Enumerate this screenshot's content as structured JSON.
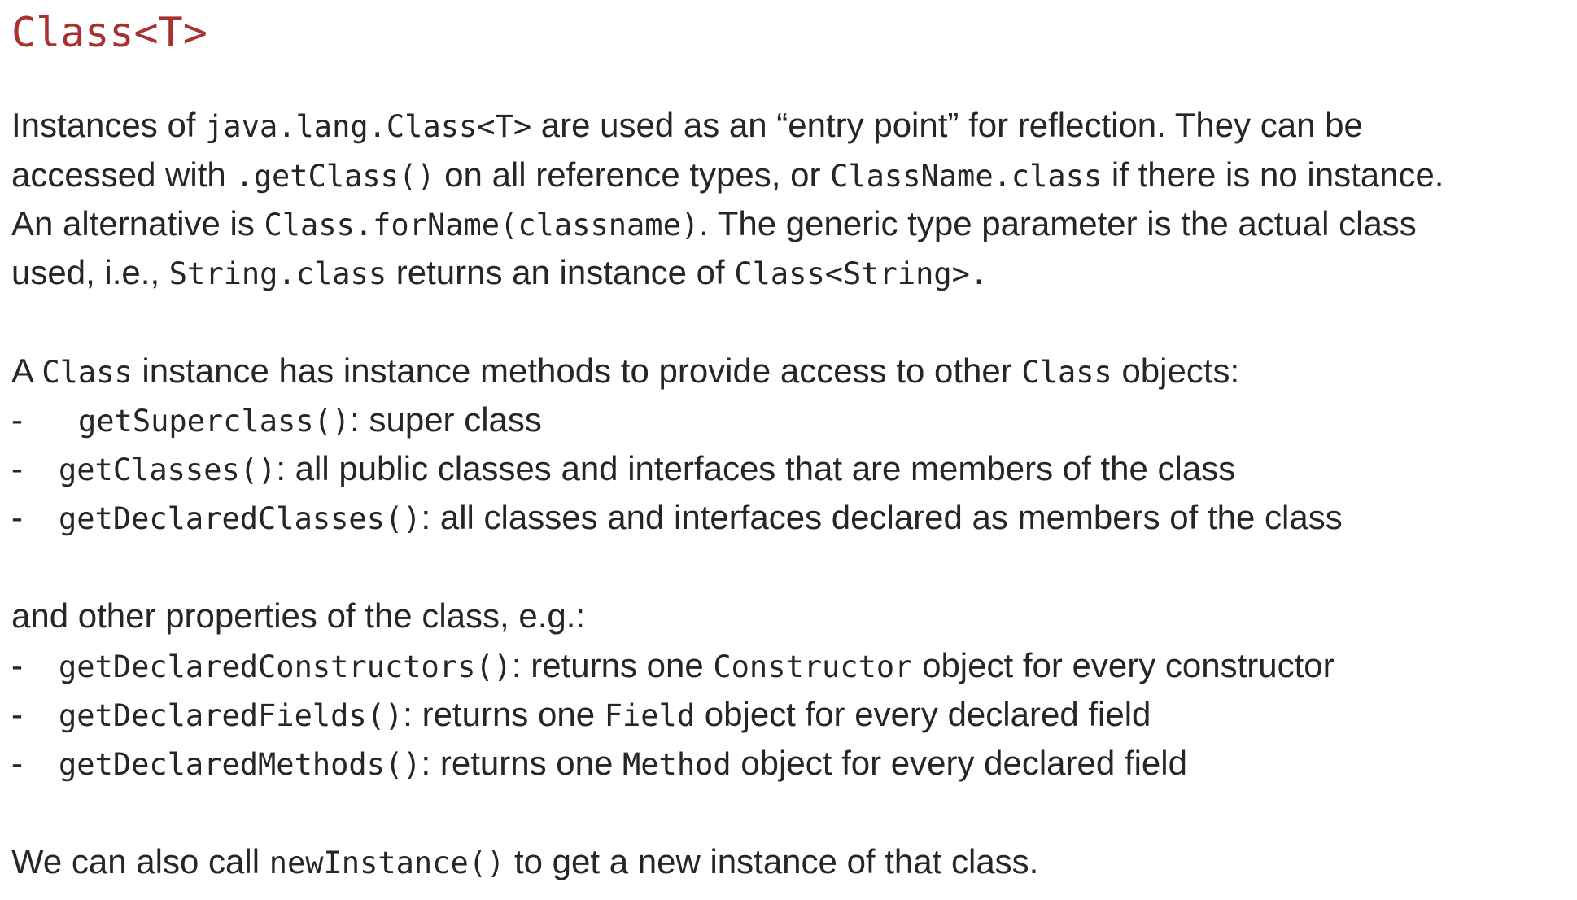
{
  "title": "Class<T>",
  "intro": {
    "l1": {
      "a": "Instances of ",
      "code1": "java.lang.Class<T>",
      "b": " are used as an “entry point” for reflection. They can be"
    },
    "l2": {
      "a": "accessed with ",
      "code1": ".getClass()",
      "b": " on all reference types, or ",
      "code2": "ClassName.class",
      "c": " if there is no instance."
    },
    "l3": {
      "a": "An alternative is ",
      "code1": "Class.forName(classname)",
      "b": ". The generic type parameter is the actual class"
    },
    "l4": {
      "a": "used, i.e., ",
      "code1": "String.class",
      "b": " returns an instance of ",
      "code2": "Class<String>."
    }
  },
  "access": {
    "lead": {
      "a": "A ",
      "code1": "Class",
      "b": " instance has instance methods to provide access to other ",
      "code2": "Class",
      "c": " objects:"
    },
    "items": [
      {
        "dash": "-",
        "code": "getSuperclass()",
        "text": ": super class"
      },
      {
        "dash": "-",
        "code": "getClasses()",
        "text": ": all public classes and interfaces that are members of the class"
      },
      {
        "dash": "-",
        "code": "getDeclaredClasses()",
        "text": ": all classes and interfaces declared as members of the class"
      }
    ]
  },
  "props": {
    "lead": "and other properties of the class, e.g.:",
    "items": [
      {
        "dash": "-",
        "code": "getDeclaredConstructors()",
        "a": ": returns one ",
        "code2": "Constructor",
        "b": " object for every constructor"
      },
      {
        "dash": "-",
        "code": "getDeclaredFields()",
        "a": ": returns one ",
        "code2": "Field",
        "b": " object for every declared field"
      },
      {
        "dash": "-",
        "code": "getDeclaredMethods()",
        "a": ": returns one ",
        "code2": "Method",
        "b": " object for every declared field"
      }
    ]
  },
  "outro": {
    "a": "We can also call ",
    "code1": "newInstance()",
    "b": " to get a new instance of that class."
  }
}
